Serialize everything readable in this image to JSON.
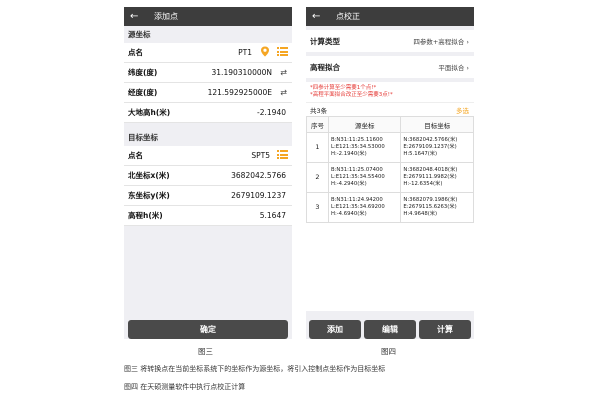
{
  "left": {
    "title": "添加点",
    "source_header": "源坐标",
    "source_rows": [
      {
        "label": "点名",
        "value": "PT1"
      },
      {
        "label": "纬度(度)",
        "value": "31.190310000N"
      },
      {
        "label": "经度(度)",
        "value": "121.592925000E"
      },
      {
        "label": "大地高h(米)",
        "value": "-2.1940"
      }
    ],
    "target_header": "目标坐标",
    "target_rows": [
      {
        "label": "点名",
        "value": "SPT5"
      },
      {
        "label": "北坐标x(米)",
        "value": "3682042.5766"
      },
      {
        "label": "东坐标y(米)",
        "value": "2679109.1237"
      },
      {
        "label": "高程h(米)",
        "value": "5.1647"
      }
    ],
    "confirm_label": "确定",
    "fig_label": "图三"
  },
  "right": {
    "title": "点校正",
    "calc_type_label": "计算类型",
    "calc_type_value": "四参数+高程拟合",
    "height_fit_label": "高程拟合",
    "height_fit_value": "平面拟合",
    "warn1": "*四参计算至少需要1个点!*",
    "warn2": "*高程平面拟合改正至少需要3点!*",
    "count": "共3条",
    "multi_select": "多选",
    "table": {
      "headers": [
        "序号",
        "源坐标",
        "目标坐标"
      ],
      "rows": [
        {
          "idx": "1",
          "src": [
            "B:N31:11:25.11600",
            "L:E121:35:34.53000",
            "H:-2.1940(米)"
          ],
          "dst": [
            "N:3682042.5766(米)",
            "E:2679109.1237(米)",
            "H:5.1647(米)"
          ]
        },
        {
          "idx": "2",
          "src": [
            "B:N31:11:25.07400",
            "L:E121:35:34.55400",
            "H:-4.2940(米)"
          ],
          "dst": [
            "N:3682048.4018(米)",
            "E:2679111.9982(米)",
            "H:-12.6354(米)"
          ]
        },
        {
          "idx": "3",
          "src": [
            "B:N31:11:24.94200",
            "L:E121:35:34.69200",
            "H:-4.6940(米)"
          ],
          "dst": [
            "N:3682079.1986(米)",
            "E:2679115.6263(米)",
            "H:4.9648(米)"
          ]
        }
      ]
    },
    "buttons": [
      "添加",
      "编辑",
      "计算"
    ],
    "fig_label": "图四"
  },
  "captions": {
    "line1": "图三 将转换点在当前坐标系统下的坐标作为源坐标，将引入控制点坐标作为目标坐标",
    "line2": "图四 在天硕测量软件中执行点校正计算"
  },
  "colors": {
    "topbar": "#3d3d3d",
    "accent": "#f5a623",
    "warning": "#e53935",
    "button": "#4a4a4a"
  },
  "icons": [
    "back-arrow-icon",
    "location-pin-icon",
    "list-icon",
    "swap-icon",
    "chevron-right-icon"
  ]
}
